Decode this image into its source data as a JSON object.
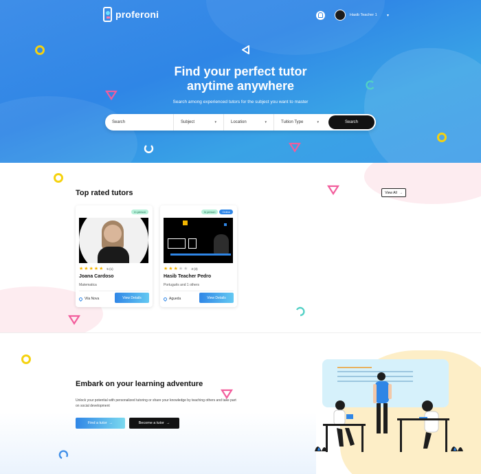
{
  "brand": {
    "name": "proferoni"
  },
  "user": {
    "name": "Hasib Teacher 1"
  },
  "hero": {
    "title_line1": "Find your perfect tutor",
    "title_line2": "anytime anywhere",
    "subtitle": "Search among experienced tutors for the subject you want to master"
  },
  "search": {
    "placeholder": "Search",
    "subject": "Subject",
    "location": "Location",
    "tuition_type": "Tuition Type",
    "button": "Search"
  },
  "top_rated": {
    "title": "Top rated tutors",
    "view_all": "View All",
    "tutors": [
      {
        "tags": [
          "In person"
        ],
        "rating": 5,
        "rating_text": "5 (1)",
        "name": "Joana Cardoso",
        "subject": "Matematica",
        "location": "Vila Nova",
        "button": "View Details"
      },
      {
        "tags": [
          "In person",
          "Online"
        ],
        "rating": 3,
        "rating_text": "3 (3)",
        "name": "Hasib Teacher Pedro",
        "subject": "Português and 1 others",
        "location": "Agueda",
        "button": "View Details"
      }
    ]
  },
  "adventure": {
    "title": "Embark on your learning adventure",
    "text": "Unlock your potential with personalized tutoring or share your knowledge by teaching others and take part on social development",
    "find_button": "Find a tutor",
    "become_button": "Become a tutor"
  },
  "colors": {
    "primary": "#2f86e6",
    "yellow": "#f5d20f",
    "pink": "#f25d9c",
    "teal": "#52d0c5"
  }
}
